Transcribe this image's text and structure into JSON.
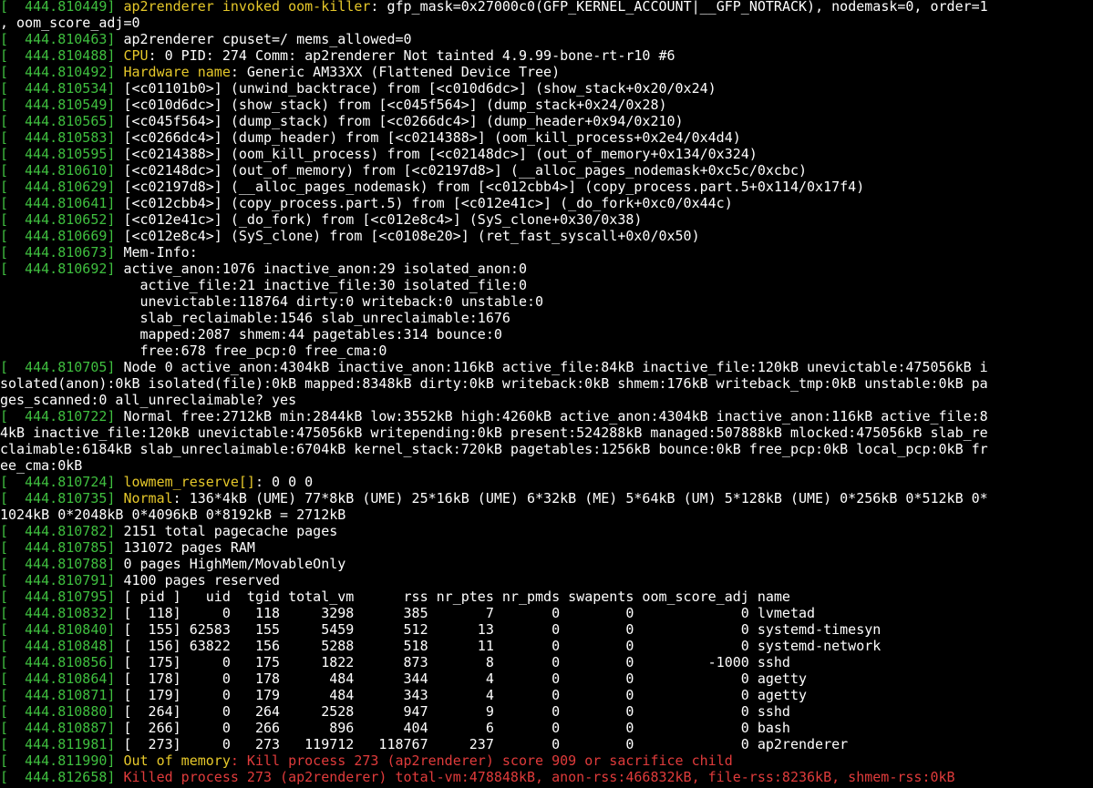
{
  "colors": {
    "timestamp": "#3fbf3f",
    "highlight": "#e6c82a",
    "alert": "#e03b3b",
    "text": "#ffffff",
    "background": "#000000"
  },
  "lines": [
    [
      [
        "[  444.810449] ",
        "g"
      ],
      [
        "ap2renderer invoked oom-killer",
        "y"
      ],
      [
        ": gfp_mask=0x27000c0(GFP_KERNEL_ACCOUNT|__GFP_NOTRACK), nodemask=0, order=1",
        "w"
      ]
    ],
    [
      [
        ", oom_score_adj=0",
        "w"
      ]
    ],
    [
      [
        "[  444.810463] ",
        "g"
      ],
      [
        "ap2renderer cpuset=/ mems_allowed=0",
        "w"
      ]
    ],
    [
      [
        "[  444.810488] ",
        "g"
      ],
      [
        "CPU",
        "y"
      ],
      [
        ": 0 PID: 274 Comm: ap2renderer Not tainted 4.9.99-bone-rt-r10 #6",
        "w"
      ]
    ],
    [
      [
        "[  444.810492] ",
        "g"
      ],
      [
        "Hardware name",
        "y"
      ],
      [
        ": Generic AM33XX (Flattened Device Tree)",
        "w"
      ]
    ],
    [
      [
        "[  444.810534] ",
        "g"
      ],
      [
        "[<c01101b0>] (unwind_backtrace) from [<c010d6dc>] (show_stack+0x20/0x24)",
        "w"
      ]
    ],
    [
      [
        "[  444.810549] ",
        "g"
      ],
      [
        "[<c010d6dc>] (show_stack) from [<c045f564>] (dump_stack+0x24/0x28)",
        "w"
      ]
    ],
    [
      [
        "[  444.810565] ",
        "g"
      ],
      [
        "[<c045f564>] (dump_stack) from [<c0266dc4>] (dump_header+0x94/0x210)",
        "w"
      ]
    ],
    [
      [
        "[  444.810583] ",
        "g"
      ],
      [
        "[<c0266dc4>] (dump_header) from [<c0214388>] (oom_kill_process+0x2e4/0x4d4)",
        "w"
      ]
    ],
    [
      [
        "[  444.810595] ",
        "g"
      ],
      [
        "[<c0214388>] (oom_kill_process) from [<c02148dc>] (out_of_memory+0x134/0x324)",
        "w"
      ]
    ],
    [
      [
        "[  444.810610] ",
        "g"
      ],
      [
        "[<c02148dc>] (out_of_memory) from [<c02197d8>] (__alloc_pages_nodemask+0xc5c/0xcbc)",
        "w"
      ]
    ],
    [
      [
        "[  444.810629] ",
        "g"
      ],
      [
        "[<c02197d8>] (__alloc_pages_nodemask) from [<c012cbb4>] (copy_process.part.5+0x114/0x17f4)",
        "w"
      ]
    ],
    [
      [
        "[  444.810641] ",
        "g"
      ],
      [
        "[<c012cbb4>] (copy_process.part.5) from [<c012e41c>] (_do_fork+0xc0/0x44c)",
        "w"
      ]
    ],
    [
      [
        "[  444.810652] ",
        "g"
      ],
      [
        "[<c012e41c>] (_do_fork) from [<c012e8c4>] (SyS_clone+0x30/0x38)",
        "w"
      ]
    ],
    [
      [
        "[  444.810669] ",
        "g"
      ],
      [
        "[<c012e8c4>] (SyS_clone) from [<c0108e20>] (ret_fast_syscall+0x0/0x50)",
        "w"
      ]
    ],
    [
      [
        "[  444.810673] ",
        "g"
      ],
      [
        "Mem-Info:",
        "w"
      ]
    ],
    [
      [
        "[  444.810692] ",
        "g"
      ],
      [
        "active_anon:1076 inactive_anon:29 isolated_anon:0",
        "w"
      ]
    ],
    [
      [
        "                ",
        "w"
      ],
      [
        " active_file:21 inactive_file:30 isolated_file:0",
        "w"
      ]
    ],
    [
      [
        "                ",
        "w"
      ],
      [
        " unevictable:118764 dirty:0 writeback:0 unstable:0",
        "w"
      ]
    ],
    [
      [
        "                ",
        "w"
      ],
      [
        " slab_reclaimable:1546 slab_unreclaimable:1676",
        "w"
      ]
    ],
    [
      [
        "                ",
        "w"
      ],
      [
        " mapped:2087 shmem:44 pagetables:314 bounce:0",
        "w"
      ]
    ],
    [
      [
        "                ",
        "w"
      ],
      [
        " free:678 free_pcp:0 free_cma:0",
        "w"
      ]
    ],
    [
      [
        "[  444.810705] ",
        "g"
      ],
      [
        "Node 0 active_anon:4304kB inactive_anon:116kB active_file:84kB inactive_file:120kB unevictable:475056kB i",
        "w"
      ]
    ],
    [
      [
        "solated(anon):0kB isolated(file):0kB mapped:8348kB dirty:0kB writeback:0kB shmem:176kB writeback_tmp:0kB unstable:0kB pa",
        "w"
      ]
    ],
    [
      [
        "ges_scanned:0 all_unreclaimable? yes",
        "w"
      ]
    ],
    [
      [
        "[  444.810722] ",
        "g"
      ],
      [
        "Normal free:2712kB min:2844kB low:3552kB high:4260kB active_anon:4304kB inactive_anon:116kB active_file:8",
        "w"
      ]
    ],
    [
      [
        "4kB inactive_file:120kB unevictable:475056kB writepending:0kB present:524288kB managed:507888kB mlocked:475056kB slab_re",
        "w"
      ]
    ],
    [
      [
        "claimable:6184kB slab_unreclaimable:6704kB kernel_stack:720kB pagetables:1256kB bounce:0kB free_pcp:0kB local_pcp:0kB fr",
        "w"
      ]
    ],
    [
      [
        "ee_cma:0kB",
        "w"
      ]
    ],
    [
      [
        "[  444.810724] ",
        "g"
      ],
      [
        "lowmem_reserve[]",
        "y"
      ],
      [
        ": 0 0 0",
        "w"
      ]
    ],
    [
      [
        "[  444.810735] ",
        "g"
      ],
      [
        "Normal",
        "y"
      ],
      [
        ": 136*4kB (UME) 77*8kB (UME) 25*16kB (UME) 6*32kB (ME) 5*64kB (UM) 5*128kB (UME) 0*256kB 0*512kB 0*",
        "w"
      ]
    ],
    [
      [
        "1024kB 0*2048kB 0*4096kB 0*8192kB = 2712kB",
        "w"
      ]
    ],
    [
      [
        "[  444.810782] ",
        "g"
      ],
      [
        "2151 total pagecache pages",
        "w"
      ]
    ],
    [
      [
        "[  444.810785] ",
        "g"
      ],
      [
        "131072 pages RAM",
        "w"
      ]
    ],
    [
      [
        "[  444.810788] ",
        "g"
      ],
      [
        "0 pages HighMem/MovableOnly",
        "w"
      ]
    ],
    [
      [
        "[  444.810791] ",
        "g"
      ],
      [
        "4100 pages reserved",
        "w"
      ]
    ],
    [
      [
        "[  444.810795] ",
        "g"
      ],
      [
        "[ pid ]   uid  tgid total_vm      rss nr_ptes nr_pmds swapents oom_score_adj name",
        "w"
      ]
    ],
    [
      [
        "[  444.810832] ",
        "g"
      ],
      [
        "[  118]     0   118     3298      385       7       0        0             0 lvmetad",
        "w"
      ]
    ],
    [
      [
        "[  444.810840] ",
        "g"
      ],
      [
        "[  155] 62583   155     5459      512      13       0        0             0 systemd-timesyn",
        "w"
      ]
    ],
    [
      [
        "[  444.810848] ",
        "g"
      ],
      [
        "[  156] 63822   156     5288      518      11       0        0             0 systemd-network",
        "w"
      ]
    ],
    [
      [
        "[  444.810856] ",
        "g"
      ],
      [
        "[  175]     0   175     1822      873       8       0        0         -1000 sshd",
        "w"
      ]
    ],
    [
      [
        "[  444.810864] ",
        "g"
      ],
      [
        "[  178]     0   178      484      344       4       0        0             0 agetty",
        "w"
      ]
    ],
    [
      [
        "[  444.810871] ",
        "g"
      ],
      [
        "[  179]     0   179      484      343       4       0        0             0 agetty",
        "w"
      ]
    ],
    [
      [
        "[  444.810880] ",
        "g"
      ],
      [
        "[  264]     0   264     2528      947       9       0        0             0 sshd",
        "w"
      ]
    ],
    [
      [
        "[  444.810887] ",
        "g"
      ],
      [
        "[  266]     0   266      896      404       6       0        0             0 bash",
        "w"
      ]
    ],
    [
      [
        "[  444.811981] ",
        "g"
      ],
      [
        "[  273]     0   273   119712   118767     237       0        0             0 ap2renderer",
        "w"
      ]
    ],
    [
      [
        "[  444.811990] ",
        "g"
      ],
      [
        "Out of memory",
        "y"
      ],
      [
        ": Kill process 273 (ap2renderer) score 909 or sacrifice child",
        "r"
      ]
    ],
    [
      [
        "[  444.812658] ",
        "g"
      ],
      [
        "Killed process 273 (ap2renderer) total-vm:478848kB, anon-rss:466832kB, file-rss:8236kB, shmem-rss:0kB",
        "r"
      ]
    ]
  ]
}
